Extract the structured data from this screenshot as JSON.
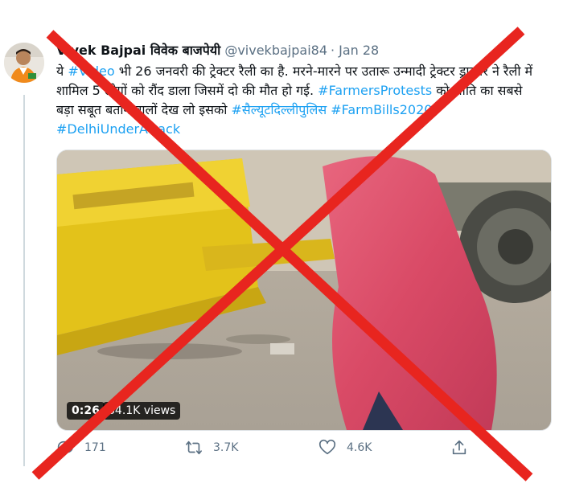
{
  "author": {
    "name": "Vivek Bajpai विवेक बाजपेयी",
    "handle": "@vivekbajpai84",
    "separator": "·",
    "date": "Jan 28"
  },
  "tweet": {
    "seg1": "ये ",
    "link1": "#Video",
    "seg2": " भी 26 जनवरी की ट्रेक्टर रैली का है. मरने-मारने पर उतारू उन्मादी ट्रेक्टर ड्राइवर ने रैली में शामिल 5 लोगों को रौंद डाला जिसमें दो की मौत हो गई.",
    "link2": "#FarmersProtests",
    "seg3": " को शांति का सबसे बड़ा सबूत बताने वालों देख लो इसको",
    "link3": "#सैल्यूटदिल्लीपुलिस",
    "link4": "#FarmBills2020",
    "link5": "#DelhiUnderAttack"
  },
  "media": {
    "duration": "0:26",
    "views": "64.1K views"
  },
  "actions": {
    "reply_count": "171",
    "retweet_count": "3.7K",
    "like_count": "4.6K"
  },
  "icons": {
    "reply": "reply-icon",
    "retweet": "retweet-icon",
    "like": "heart-icon",
    "share": "share-icon"
  },
  "colors": {
    "link": "#1da1f2",
    "muted": "#5b7083",
    "cross": "#e8251f"
  }
}
